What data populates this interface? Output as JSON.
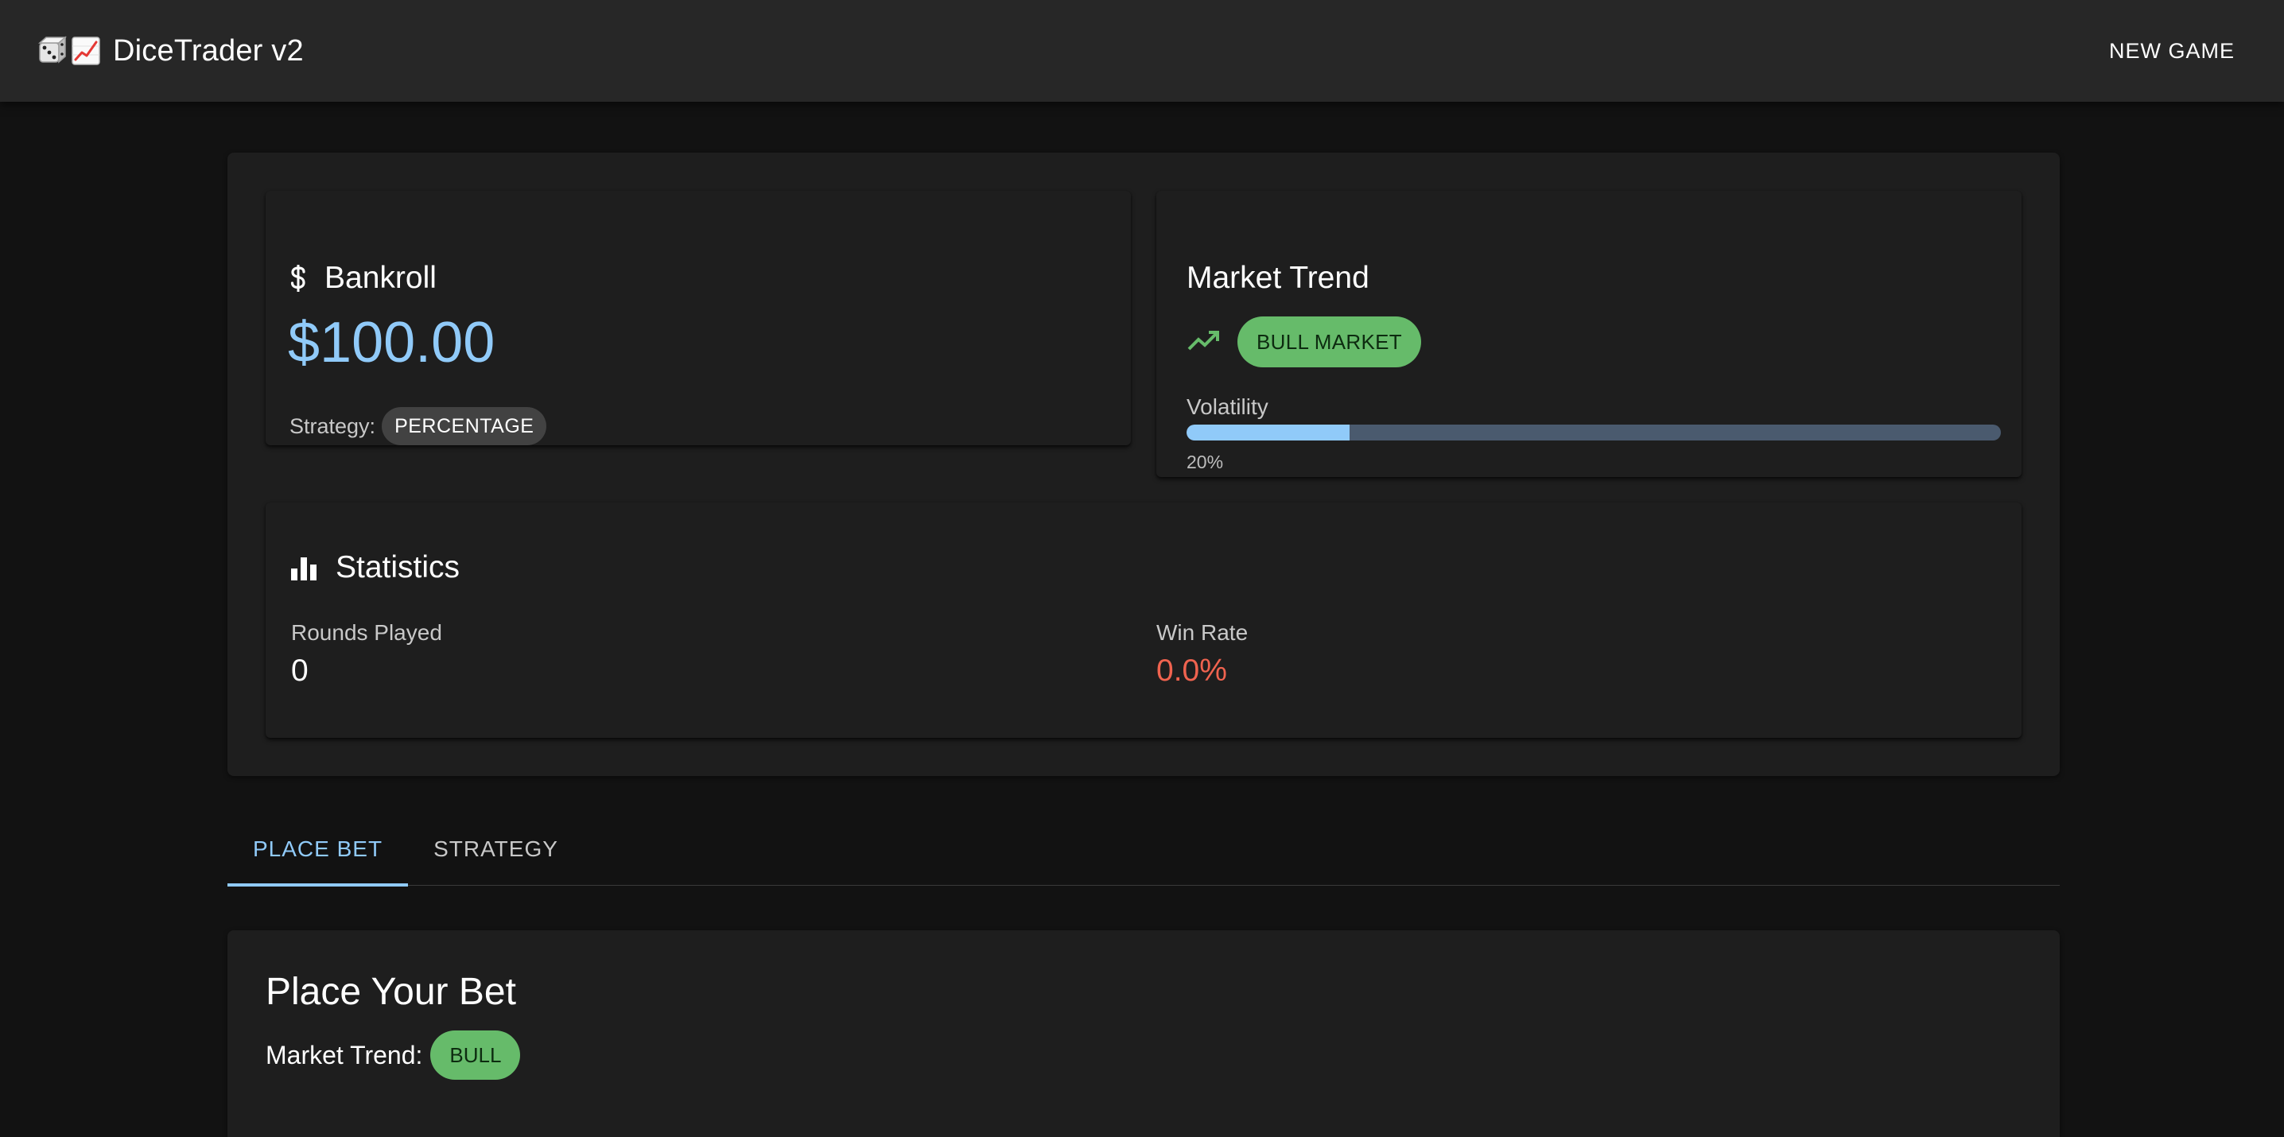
{
  "app": {
    "title": "DiceTrader v2",
    "new_game_label": "NEW GAME"
  },
  "bankroll": {
    "title": "Bankroll",
    "value": "$100.00",
    "strategy_label": "Strategy:",
    "strategy_value": "PERCENTAGE"
  },
  "market": {
    "title": "Market Trend",
    "trend_chip": "BULL MARKET",
    "volatility_label": "Volatility",
    "volatility_fraction": 0.2,
    "volatility_text": "20%"
  },
  "statistics": {
    "title": "Statistics",
    "rounds_label": "Rounds Played",
    "rounds_value": "0",
    "winrate_label": "Win Rate",
    "winrate_value": "0.0%"
  },
  "tabs": [
    {
      "label": "PLACE BET",
      "active": true
    },
    {
      "label": "STRATEGY",
      "active": false
    }
  ],
  "bet_panel": {
    "title": "Place Your Bet",
    "trend_label": "Market Trend:",
    "trend_chip": "BULL"
  },
  "colors": {
    "primary": "#90caf9",
    "bull": "#66bb6a",
    "loss": "#f0634f",
    "background": "#121212",
    "surface": "#1e1e1e"
  },
  "icons": {
    "logo": [
      "dice-icon",
      "chart-increasing-icon"
    ],
    "bankroll": "dollar-icon",
    "trend": "trending-up-icon",
    "statistics": "bar-chart-icon"
  }
}
